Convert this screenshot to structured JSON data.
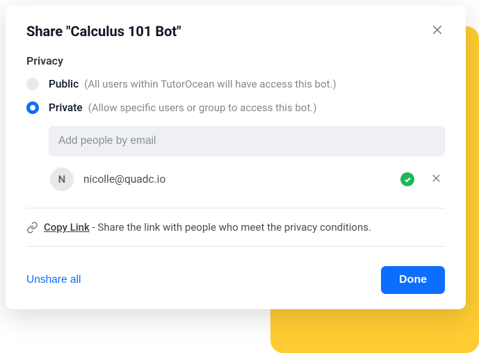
{
  "modal": {
    "title": "Share \"Calculus 101 Bot\""
  },
  "privacy": {
    "section_label": "Privacy",
    "public": {
      "label": "Public",
      "hint": "(All users within TutorOcean will have access this bot.)",
      "selected": false
    },
    "private": {
      "label": "Private",
      "hint": "(Allow specific users or group to access this bot.)",
      "selected": true
    }
  },
  "email_input": {
    "placeholder": "Add people by email",
    "value": ""
  },
  "people": [
    {
      "initial": "N",
      "email": "nicolle@quadc.io",
      "verified": true
    }
  ],
  "copy_link": {
    "label": "Copy Link",
    "description": " - Share the link with people who meet the privacy conditions."
  },
  "footer": {
    "unshare_label": "Unshare all",
    "done_label": "Done"
  }
}
